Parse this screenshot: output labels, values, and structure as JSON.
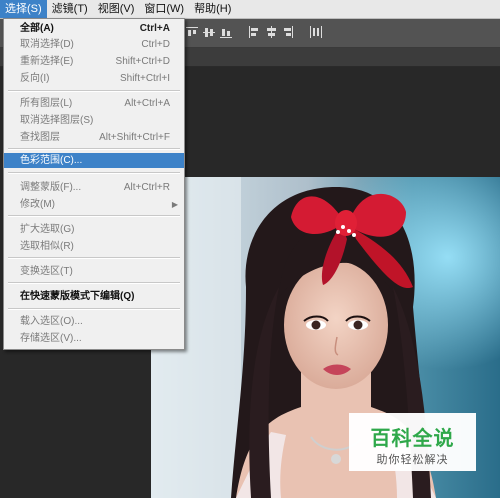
{
  "menubar": {
    "items": [
      {
        "label": "选择(S)",
        "active": true
      },
      {
        "label": "滤镜(T)",
        "active": false
      },
      {
        "label": "视图(V)",
        "active": false
      },
      {
        "label": "窗口(W)",
        "active": false
      },
      {
        "label": "帮助(H)",
        "active": false
      }
    ]
  },
  "select_menu": {
    "items": [
      {
        "label": "全部(A)",
        "shortcut": "Ctrl+A",
        "enabled": true
      },
      {
        "label": "取消选择(D)",
        "shortcut": "Ctrl+D",
        "enabled": false
      },
      {
        "label": "重新选择(E)",
        "shortcut": "Shift+Ctrl+D",
        "enabled": false
      },
      {
        "label": "反向(I)",
        "shortcut": "Shift+Ctrl+I",
        "enabled": false
      },
      {
        "label": "所有图层(L)",
        "shortcut": "Alt+Ctrl+A",
        "enabled": false
      },
      {
        "label": "取消选择图层(S)",
        "shortcut": "",
        "enabled": false
      },
      {
        "label": "查找图层",
        "shortcut": "Alt+Shift+Ctrl+F",
        "enabled": false
      },
      {
        "label": "色彩范围(C)...",
        "shortcut": "",
        "enabled": true,
        "highlighted": true
      },
      {
        "label": "调整蒙版(F)...",
        "shortcut": "Alt+Ctrl+R",
        "enabled": false
      },
      {
        "label": "修改(M)",
        "shortcut": "",
        "enabled": false,
        "submenu": true
      },
      {
        "label": "扩大选取(G)",
        "shortcut": "",
        "enabled": false
      },
      {
        "label": "选取相似(R)",
        "shortcut": "",
        "enabled": false
      },
      {
        "label": "变换选区(T)",
        "shortcut": "",
        "enabled": false
      },
      {
        "label": "在快速蒙版模式下编辑(Q)",
        "shortcut": "",
        "enabled": true,
        "bold": true
      },
      {
        "label": "载入选区(O)...",
        "shortcut": "",
        "enabled": false
      },
      {
        "label": "存储选区(V)...",
        "shortcut": "",
        "enabled": false
      }
    ]
  },
  "watermark": {
    "logo_text": "百科全说",
    "slogan": "助你轻松解决"
  },
  "colors": {
    "menu_highlight": "#3d82c8",
    "workspace_bg": "#282828",
    "options_bar": "#535353",
    "watermark_green": "#2fa84a"
  }
}
